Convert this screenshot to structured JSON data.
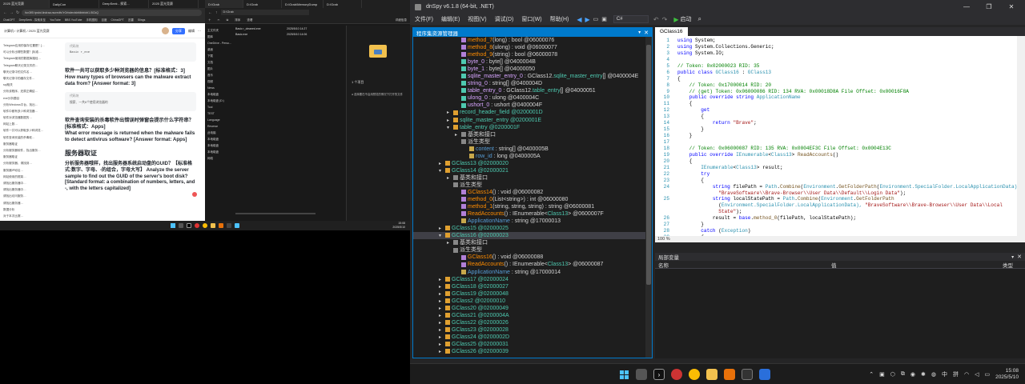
{
  "browser": {
    "tabs": [
      "2025 蓝光竞赛",
      "DailyCon",
      "DeepSeek - 探索...",
      "2025 蓝光竞赛"
    ],
    "url": "fun3fl5 tpsbd.lindraa.rscredfs?rOrbden/sbfdbbfcbt1.l5CkQ",
    "bookmarks": [
      "ChatGPT",
      "DeepSeek - 探索未至",
      "YouTube",
      "BBS YouTube",
      "手机图相",
      "百度",
      "ChinaGPT",
      "迅雷",
      "Slings"
    ],
    "breadcrumb": "计算机 / 计算机 / 2025 蓝光竞赛",
    "doc_title": "2025 蓝光竞赛",
    "share_label": "分享",
    "edit_label": "编辑",
    "sidebar_lines": [
      "Telegram应用的保存位置是？[…",
      "可以分析出哪些数据？[标准…",
      "Telegram使用的数据库路径…",
      "Telegram聊天记录文件的…",
      "聊天记录中的文件名…",
      "聊天记录中的缓存文件…",
      "sql相关",
      "分析该程序，还原正确结…",
      "exe分析题目",
      "分析Windows平台，找出…",
      "软件中都有多少种浏览器…",
      "软件对浏览器数据的…",
      "网站上数…",
      "软件一共可以获取多少种浏览…",
      "软件查询安装的杀毒软…",
      "服务器取证",
      "分析服务器软件，找出服务…",
      "服务器取证",
      "分析服务器，请找到…",
      "服务器IP地址…",
      "网站使用的框架…",
      "请找出服务器中…",
      "请找出服务器中…",
      "请找出访问服务…",
      "请找出服务器…",
      "数据分析",
      "对于本次比赛…"
    ],
    "code_box_1_label": "代码块",
    "code_box_1_text": "Basic r_exe",
    "q1_zh": "软件一共可以获取多少种浏览器的信息？[标准格式：3]",
    "q1_en": "How many types of browsers can the malware extract data from? [Answer format: 3]",
    "code_box_2_label": "代码块",
    "code_box_2_text": "搜索、一共6个使用浏览器的",
    "q2_zh": "软件查询安装的杀毒软件出错误时弹窗会提示什么字符串？[标准格式：Apps]",
    "q2_en": "What error message is returned when the malware fails to detect antivirus software? [Answer format: Apps]",
    "section_title": "服务器取证",
    "q3_zh": "分析服务器哦样，找出服务器系统启动盘的GUID？【标准格式:数字、字母、-的组合，字母大写】",
    "q3_en": "Analyze the server sample to find out the GUID of the server's boot disk? [Standard format: a combination of numbers, letters, and -, with the letters capitalized]"
  },
  "explorer": {
    "tabs": [
      "D:\\Grab",
      "D:\\Grab",
      "D:\\Grab\\MemoryDump",
      "D:\\Grab"
    ],
    "path": "D:\\Grab",
    "nav_items": [
      "主文件夹",
      "图库",
      "OneDrive - Perso...",
      "桌面",
      "下载",
      "文档",
      "图片",
      "音乐",
      "视频",
      "News",
      "本地磁盘",
      "本地磁盘 (D:)",
      "Tool",
      "TEST",
      "Language",
      "Reverse",
      "此电脑",
      "本地磁盘",
      "本地磁盘",
      "本地磁盘",
      "网络"
    ],
    "files": [
      {
        "name": "Basic r_cleaned.exe",
        "date": "2025/5/10 14:27"
      },
      {
        "name": "Basic.exe",
        "date": "2025/5/10 14:06"
      }
    ],
    "sort_label": "排序",
    "view_label": "查看",
    "details_label": "详细信息",
    "status_text": "2 个项目",
    "selected_text": "1 个项目",
    "preview_text": "选择要在不启用预览的情况下打开的文件",
    "file_section": "D:\\Grab"
  },
  "taskbar_left": {
    "time": "15:08",
    "date": "2025/5/10"
  },
  "dnspy": {
    "title": "dnSpy v6.1.8 (64-bit, .NET)",
    "menu": [
      "文件(F)",
      "编辑(E)",
      "视图(V)",
      "调试(D)",
      "窗口(W)",
      "帮助(H)"
    ],
    "lang": "C#",
    "start_label": "启动",
    "assembly_explorer_title": "程序集资源管理器",
    "code_tab": "GClass16",
    "zoom": "100 %",
    "locals_title": "局部变量",
    "locals_cols": [
      "名称",
      "值",
      "类型"
    ],
    "tree": [
      {
        "indent": 6,
        "parts": [
          [
            "method_7",
            "o"
          ],
          [
            "(long) : bool @06000076",
            "w"
          ]
        ]
      },
      {
        "indent": 6,
        "parts": [
          [
            "method_8",
            "o"
          ],
          [
            "(ulong) : void @06000077",
            "w"
          ]
        ]
      },
      {
        "indent": 6,
        "parts": [
          [
            "method_9",
            "o"
          ],
          [
            "(string) : bool @06000078",
            "w"
          ]
        ]
      },
      {
        "indent": 6,
        "parts": [
          [
            "byte_0",
            "p"
          ],
          [
            " : byte[] @0400004B",
            "w"
          ]
        ]
      },
      {
        "indent": 6,
        "parts": [
          [
            "byte_1",
            "p"
          ],
          [
            " : byte[] @04000050",
            "w"
          ]
        ]
      },
      {
        "indent": 6,
        "parts": [
          [
            "sqlite_master_entry_0",
            "p"
          ],
          [
            " : GClass12.",
            "w"
          ],
          [
            "sqlite_master_entry",
            "g"
          ],
          [
            "[] @0400004E",
            "w"
          ]
        ]
      },
      {
        "indent": 6,
        "parts": [
          [
            "string_0",
            "p"
          ],
          [
            " : string[] @0400004D",
            "w"
          ]
        ]
      },
      {
        "indent": 6,
        "parts": [
          [
            "table_entry_0",
            "p"
          ],
          [
            " : GClass12.",
            "w"
          ],
          [
            "table_entry",
            "g"
          ],
          [
            "[] @04000051",
            "w"
          ]
        ]
      },
      {
        "indent": 6,
        "parts": [
          [
            "ulong_0",
            "p"
          ],
          [
            " : ulong @0400004C",
            "w"
          ]
        ]
      },
      {
        "indent": 6,
        "parts": [
          [
            "ushort_0",
            "p"
          ],
          [
            " : ushort @0400004F",
            "w"
          ]
        ]
      },
      {
        "indent": 5,
        "exp": "+",
        "parts": [
          [
            "record_header_field @0200001D",
            "g"
          ]
        ]
      },
      {
        "indent": 5,
        "exp": "+",
        "parts": [
          [
            "sqlite_master_entry @0200001E",
            "g"
          ]
        ]
      },
      {
        "indent": 5,
        "exp": "-",
        "parts": [
          [
            "table_entry @0200001F",
            "g"
          ]
        ]
      },
      {
        "indent": 6,
        "exp": "+",
        "parts": [
          [
            "基类和接口",
            "w"
          ]
        ]
      },
      {
        "indent": 6,
        "parts": [
          [
            "派生类型",
            "w"
          ]
        ]
      },
      {
        "indent": 7,
        "parts": [
          [
            "content",
            "b"
          ],
          [
            " : string[] @0400005B",
            "w"
          ]
        ]
      },
      {
        "indent": 7,
        "parts": [
          [
            "row_id",
            "b"
          ],
          [
            " : long @0400005A",
            "w"
          ]
        ]
      },
      {
        "indent": 4,
        "exp": "+",
        "parts": [
          [
            "GClass13 @02000020",
            "g"
          ]
        ]
      },
      {
        "indent": 4,
        "exp": "-",
        "parts": [
          [
            "GClass14 @02000021",
            "g"
          ]
        ]
      },
      {
        "indent": 5,
        "exp": "+",
        "parts": [
          [
            "基类和接口",
            "w"
          ]
        ]
      },
      {
        "indent": 5,
        "parts": [
          [
            "派生类型",
            "w"
          ]
        ]
      },
      {
        "indent": 6,
        "parts": [
          [
            "GClass14",
            "o"
          ],
          [
            "() : void @06000082",
            "w"
          ]
        ]
      },
      {
        "indent": 6,
        "parts": [
          [
            "method_0",
            "o"
          ],
          [
            "(List<string>) : int @06000080",
            "w"
          ]
        ]
      },
      {
        "indent": 6,
        "parts": [
          [
            "method_1",
            "o"
          ],
          [
            "(string, string, string) : string @06000081",
            "w"
          ]
        ]
      },
      {
        "indent": 6,
        "parts": [
          [
            "ReadAccounts",
            "o"
          ],
          [
            "() : IEnumerable<",
            "w"
          ],
          [
            "Class13",
            "g"
          ],
          [
            "> @0600007F",
            "w"
          ]
        ]
      },
      {
        "indent": 6,
        "parts": [
          [
            "ApplicationName",
            "b"
          ],
          [
            " : string @17000013",
            "w"
          ]
        ]
      },
      {
        "indent": 4,
        "exp": "+",
        "parts": [
          [
            "GClass15 @02000025",
            "g"
          ]
        ]
      },
      {
        "indent": 4,
        "exp": "-",
        "sel": true,
        "parts": [
          [
            "GClass16 @02000023",
            "g"
          ]
        ]
      },
      {
        "indent": 5,
        "exp": "+",
        "parts": [
          [
            "基类和接口",
            "w"
          ]
        ]
      },
      {
        "indent": 5,
        "parts": [
          [
            "派生类型",
            "w"
          ]
        ]
      },
      {
        "indent": 6,
        "parts": [
          [
            "GClass16",
            "o"
          ],
          [
            "() : void @06000088",
            "w"
          ]
        ]
      },
      {
        "indent": 6,
        "parts": [
          [
            "ReadAccounts",
            "o"
          ],
          [
            "() : IEnumerable<",
            "w"
          ],
          [
            "Class13",
            "g"
          ],
          [
            "> @06000087",
            "w"
          ]
        ]
      },
      {
        "indent": 6,
        "parts": [
          [
            "ApplicationName",
            "b"
          ],
          [
            " : string @17000014",
            "w"
          ]
        ]
      },
      {
        "indent": 4,
        "exp": "+",
        "parts": [
          [
            "GClass17 @02000024",
            "g"
          ]
        ]
      },
      {
        "indent": 4,
        "exp": "+",
        "parts": [
          [
            "GClass18 @02000027",
            "g"
          ]
        ]
      },
      {
        "indent": 4,
        "exp": "+",
        "parts": [
          [
            "GClass19 @02000048",
            "g"
          ]
        ]
      },
      {
        "indent": 4,
        "exp": "+",
        "parts": [
          [
            "GClass2 @02000010",
            "g"
          ]
        ]
      },
      {
        "indent": 4,
        "exp": "+",
        "parts": [
          [
            "GClass20 @02000049",
            "g"
          ]
        ]
      },
      {
        "indent": 4,
        "exp": "+",
        "parts": [
          [
            "GClass21 @0200004A",
            "g"
          ]
        ]
      },
      {
        "indent": 4,
        "exp": "+",
        "parts": [
          [
            "GClass22 @02000026",
            "g"
          ]
        ]
      },
      {
        "indent": 4,
        "exp": "+",
        "parts": [
          [
            "GClass23 @02000028",
            "g"
          ]
        ]
      },
      {
        "indent": 4,
        "exp": "+",
        "parts": [
          [
            "GClass24 @0200002D",
            "g"
          ]
        ]
      },
      {
        "indent": 4,
        "exp": "+",
        "parts": [
          [
            "GClass25 @02000031",
            "g"
          ]
        ]
      },
      {
        "indent": 4,
        "exp": "+",
        "parts": [
          [
            "GClass26 @02000039",
            "g"
          ]
        ]
      }
    ],
    "code": [
      {
        "n": "1",
        "t": [
          [
            "using ",
            "k"
          ],
          [
            "System",
            "p"
          ],
          [
            ";",
            "p"
          ]
        ]
      },
      {
        "n": "2",
        "t": [
          [
            "using ",
            "k"
          ],
          [
            "System.Collections.Generic",
            "p"
          ],
          [
            ";",
            "p"
          ]
        ]
      },
      {
        "n": "3",
        "t": [
          [
            "using ",
            "k"
          ],
          [
            "System.IO",
            "p"
          ],
          [
            ";",
            "p"
          ]
        ]
      },
      {
        "n": "4",
        "t": []
      },
      {
        "n": "5",
        "t": [
          [
            "// Token: 0x02000023 RID: 35",
            "c"
          ]
        ]
      },
      {
        "n": "6",
        "t": [
          [
            "public class ",
            "k"
          ],
          [
            "GClass16",
            "t"
          ],
          [
            " : ",
            "p"
          ],
          [
            "GClass13",
            "t"
          ]
        ]
      },
      {
        "n": "7",
        "t": [
          [
            "{",
            "p"
          ]
        ]
      },
      {
        "n": "8",
        "t": [
          [
            "    // Token: 0x17000014 RID: 20",
            "c"
          ]
        ]
      },
      {
        "n": "9",
        "t": [
          [
            "    // (get) Token: 0x06000086 RID: 134 RVA: 0x00018D8A File Offset: 0x00016F8A",
            "c"
          ]
        ]
      },
      {
        "n": "10",
        "t": [
          [
            "    public override string ",
            "k"
          ],
          [
            "ApplicationName",
            "t"
          ]
        ]
      },
      {
        "n": "11",
        "t": [
          [
            "    {",
            "p"
          ]
        ]
      },
      {
        "n": "12",
        "t": [
          [
            "        get",
            "k"
          ]
        ]
      },
      {
        "n": "13",
        "t": [
          [
            "        {",
            "p"
          ]
        ]
      },
      {
        "n": "14",
        "t": [
          [
            "            return ",
            "k"
          ],
          [
            "\"Brave\"",
            "s"
          ],
          [
            ";",
            "p"
          ]
        ]
      },
      {
        "n": "15",
        "t": [
          [
            "        }",
            "p"
          ]
        ]
      },
      {
        "n": "16",
        "t": [
          [
            "    }",
            "p"
          ]
        ]
      },
      {
        "n": "17",
        "t": []
      },
      {
        "n": "18",
        "t": [
          [
            "    // Token: 0x06000087 RID: 135 RVA: 0x0004EF3C File Offset: 0x0004E13C",
            "c"
          ]
        ]
      },
      {
        "n": "19",
        "t": [
          [
            "    public override ",
            "k"
          ],
          [
            "IEnumerable",
            "t"
          ],
          [
            "<",
            "p"
          ],
          [
            "Class13",
            "t"
          ],
          [
            "> ",
            "p"
          ],
          [
            "ReadAccounts",
            "m"
          ],
          [
            "()",
            "p"
          ]
        ]
      },
      {
        "n": "20",
        "t": [
          [
            "    {",
            "p"
          ]
        ]
      },
      {
        "n": "21",
        "t": [
          [
            "        ",
            "p"
          ],
          [
            "IEnumerable",
            "t"
          ],
          [
            "<",
            "p"
          ],
          [
            "Class13",
            "t"
          ],
          [
            "> result;",
            "p"
          ]
        ]
      },
      {
        "n": "22",
        "t": [
          [
            "        try",
            "k"
          ]
        ]
      },
      {
        "n": "23",
        "t": [
          [
            "        {",
            "p"
          ]
        ]
      },
      {
        "n": "24",
        "t": [
          [
            "            string ",
            "k"
          ],
          [
            "filePath = ",
            "p"
          ],
          [
            "Path",
            "t"
          ],
          [
            ".",
            "p"
          ],
          [
            "Combine",
            "m"
          ],
          [
            "(",
            "p"
          ],
          [
            "Environment",
            "t"
          ],
          [
            ".",
            "p"
          ],
          [
            "GetFolderPath",
            "m"
          ],
          [
            "(",
            "p"
          ],
          [
            "Environment",
            "t"
          ],
          [
            ".SpecialFolder.LocalApplicationData),",
            "t"
          ]
        ]
      },
      {
        "n": "",
        "t": [
          [
            "              \"BraveSoftware\\\\Brave-Browser\\\\User Data\\\\Default\\\\Login Data\"",
            "s"
          ],
          [
            ");",
            "p"
          ]
        ]
      },
      {
        "n": "25",
        "t": [
          [
            "            string ",
            "k"
          ],
          [
            "localStatePath = ",
            "p"
          ],
          [
            "Path",
            "t"
          ],
          [
            ".",
            "p"
          ],
          [
            "Combine",
            "m"
          ],
          [
            "(",
            "p"
          ],
          [
            "Environment",
            "t"
          ],
          [
            ".",
            "p"
          ],
          [
            "GetFolderPath",
            "m"
          ]
        ]
      },
      {
        "n": "",
        "t": [
          [
            "              (",
            "p"
          ],
          [
            "Environment",
            "t"
          ],
          [
            ".SpecialFolder.LocalApplicationData), ",
            "t"
          ],
          [
            "\"BraveSoftware\\\\Brave-Browser\\\\User Data\\\\Local",
            "s"
          ]
        ]
      },
      {
        "n": "",
        "t": [
          [
            "              State\"",
            "s"
          ],
          [
            ");",
            "p"
          ]
        ]
      },
      {
        "n": "26",
        "t": [
          [
            "            result = ",
            "p"
          ],
          [
            "base",
            "k"
          ],
          [
            ".",
            "p"
          ],
          [
            "method_0",
            "m"
          ],
          [
            "(filePath, localStatePath);",
            "p"
          ]
        ]
      },
      {
        "n": "27",
        "t": [
          [
            "        }",
            "p"
          ]
        ]
      },
      {
        "n": "28",
        "t": [
          [
            "        catch ",
            "k"
          ],
          [
            "(",
            "p"
          ],
          [
            "Exception",
            "t"
          ],
          [
            ")",
            "p"
          ]
        ]
      },
      {
        "n": "29",
        "t": [
          [
            "        {",
            "p"
          ]
        ]
      }
    ]
  },
  "taskbar_right": {
    "time": "15:08",
    "date": "2025/5/10",
    "ime": "中",
    "ime2": "拼"
  }
}
